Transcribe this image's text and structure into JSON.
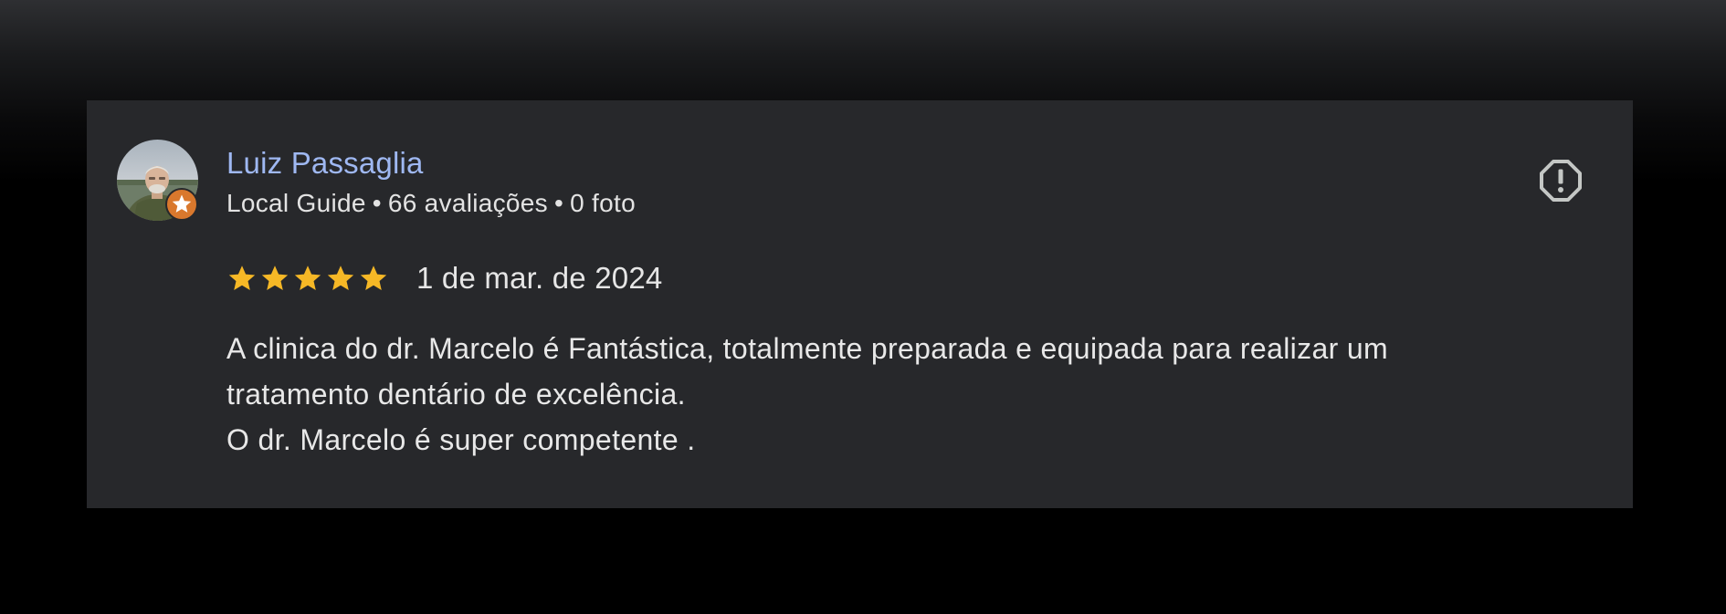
{
  "review": {
    "author": {
      "name": "Luiz Passaglia",
      "badge": "Local Guide",
      "reviews_count": "66 avaliações",
      "photos_count": "0 foto",
      "separator": "•",
      "avatar_icon": "user-photo",
      "badge_icon": "local-guide-star-icon",
      "badge_color": "#d9782d"
    },
    "rating": {
      "stars": 5,
      "max": 5,
      "star_color": "#f6b826"
    },
    "date": "1 de mar. de 2024",
    "text_lines": [
      "A clinica do dr. Marcelo é Fantástica, totalmente preparada e equipada para realizar um",
      "tratamento dentário de excelência.",
      "O dr. Marcelo é super competente ."
    ],
    "report_icon": "report-flag-icon"
  },
  "colors": {
    "card_background": "#27282b",
    "name_color": "#9fb8f2",
    "text_color": "#e3e3e3",
    "icon_color": "#c4c7c5"
  }
}
